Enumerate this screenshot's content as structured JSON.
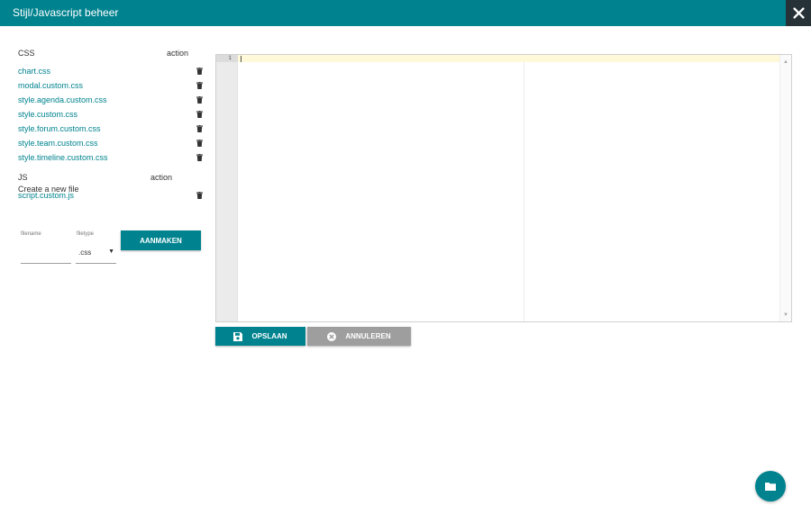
{
  "window": {
    "title": "Stijl/Javascript beheer",
    "close_icon": "close-icon"
  },
  "css_section": {
    "header": "CSS",
    "action_header": "action",
    "files": [
      "chart.css",
      "modal.custom.css",
      "style.agenda.custom.css",
      "style.custom.css",
      "style.forum.custom.css",
      "style.team.custom.css",
      "style.timeline.custom.css"
    ]
  },
  "js_section": {
    "header": "JS",
    "action_header": "action",
    "files": [
      "script.custom.js"
    ]
  },
  "create": {
    "label": "Create a new file",
    "filename_label": "filename",
    "filename_value": "",
    "filetype_label": "filetype",
    "filetype_value": ".css",
    "button": "AANMAKEN"
  },
  "editor": {
    "line_number": "1"
  },
  "actions": {
    "save": "OPSLAAN",
    "cancel": "ANNULEREN"
  },
  "colors": {
    "accent": "#00838f",
    "close_bg": "#263238",
    "disabled": "#9e9e9e"
  }
}
